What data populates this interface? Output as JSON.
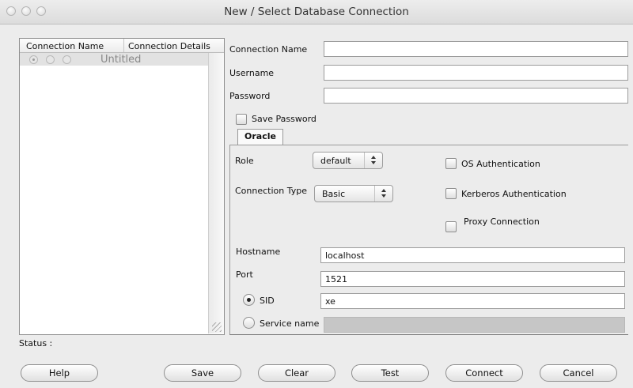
{
  "window": {
    "title": "New / Select Database Connection"
  },
  "connections_list": {
    "columns": [
      "Connection Name",
      "Connection Details"
    ],
    "rows": [
      {
        "name": "Untitled"
      }
    ]
  },
  "form": {
    "connection_name": {
      "label": "Connection Name",
      "value": ""
    },
    "username": {
      "label": "Username",
      "value": ""
    },
    "password": {
      "label": "Password",
      "value": ""
    },
    "save_password": {
      "label": "Save Password",
      "checked": false
    }
  },
  "tabs": [
    {
      "label": "Oracle",
      "selected": true
    }
  ],
  "oracle": {
    "role": {
      "label": "Role",
      "value": "default"
    },
    "connection_type": {
      "label": "Connection Type",
      "value": "Basic"
    },
    "os_auth": {
      "label": "OS Authentication",
      "checked": false
    },
    "kerberos_auth": {
      "label": "Kerberos Authentication",
      "checked": false
    },
    "proxy": {
      "label": "Proxy Connection",
      "checked": false
    },
    "hostname": {
      "label": "Hostname",
      "value": "localhost"
    },
    "port": {
      "label": "Port",
      "value": "1521"
    },
    "sid": {
      "label": "SID",
      "value": "xe",
      "selected": true
    },
    "service_name": {
      "label": "Service name",
      "value": "",
      "selected": false
    }
  },
  "status": {
    "label": "Status :",
    "value": ""
  },
  "buttons": {
    "help": "Help",
    "save": "Save",
    "clear": "Clear",
    "test": "Test",
    "connect": "Connect",
    "cancel": "Cancel"
  }
}
